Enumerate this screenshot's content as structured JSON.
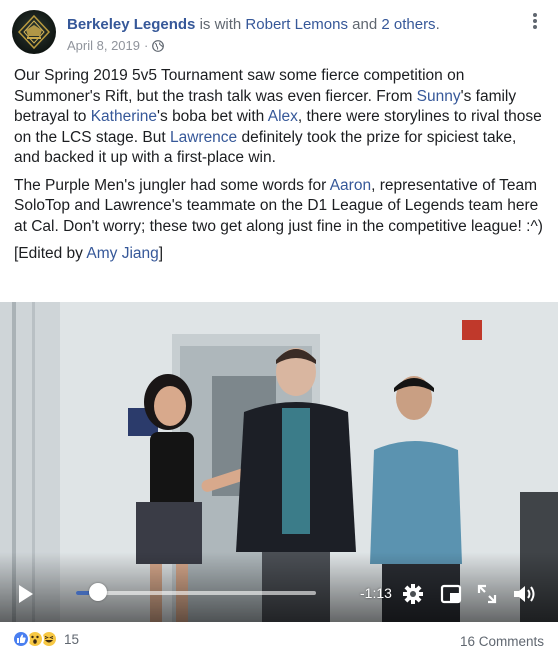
{
  "header": {
    "page_name": "Berkeley Legends",
    "is_with_text": " is with ",
    "tagged_person": "Robert Lemons",
    "and_text": " and ",
    "others": "2 others",
    "period": ".",
    "date": "April 8, 2019",
    "separator": "·",
    "privacy_icon": "globe-icon",
    "more_icon": "more-options-icon"
  },
  "post": {
    "p1": [
      {
        "text": "Our Spring 2019 5v5 Tournament saw some fierce competition on Summoner's Rift, but the trash talk was even fiercer. From ",
        "link": false
      },
      {
        "text": "Sunny",
        "link": true
      },
      {
        "text": "'s family betrayal to ",
        "link": false
      },
      {
        "text": "Katherine",
        "link": true
      },
      {
        "text": "'s boba bet with ",
        "link": false
      },
      {
        "text": "Alex",
        "link": true
      },
      {
        "text": ", there were storylines to rival those on the LCS stage. But ",
        "link": false
      },
      {
        "text": "Lawrence",
        "link": true
      },
      {
        "text": " definitely took the prize for spiciest take, and backed it up with a first-place win.",
        "link": false
      }
    ],
    "p2": [
      {
        "text": "The Purple Men's jungler had some words for ",
        "link": false
      },
      {
        "text": "Aaron",
        "link": true
      },
      {
        "text": ", representative of Team SoloTop and Lawrence's teammate on the D1 League of Legends team here at Cal. Don't worry; these two get along just fine in the competitive league! :^)",
        "link": false
      }
    ],
    "p3": [
      {
        "text": "[Edited by ",
        "link": false
      },
      {
        "text": "Amy Jiang",
        "link": true
      },
      {
        "text": "]",
        "link": false
      }
    ]
  },
  "video": {
    "progress": 0.09,
    "time_remaining": "-1:13",
    "controls": [
      "play-icon",
      "settings-icon",
      "picture-in-picture-icon",
      "fullscreen-icon",
      "volume-icon"
    ]
  },
  "footer": {
    "reaction_icons": [
      "like-icon",
      "wow-icon",
      "haha-icon"
    ],
    "reaction_count": "15",
    "comments": "16 Comments"
  },
  "colors": {
    "link": "#365899",
    "accent": "#4267b2",
    "text": "#1c1e21",
    "muted": "#606770"
  }
}
